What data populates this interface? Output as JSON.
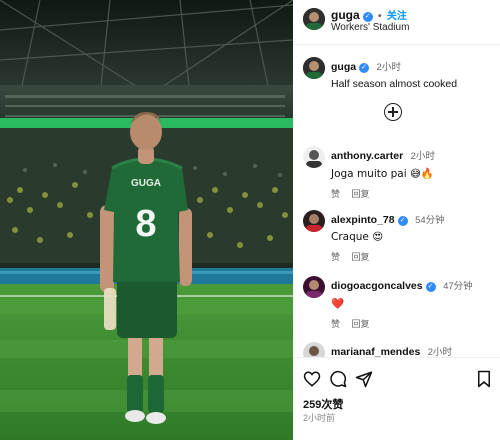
{
  "header": {
    "username": "guga",
    "verified_mark": "✓",
    "separator": "•",
    "follow_label": "关注",
    "location": "Workers' Stadium"
  },
  "photo": {
    "jersey_name": "GUGA",
    "jersey_number": "8"
  },
  "caption": {
    "username": "guga",
    "time": "2小时",
    "text": "Half season almost cooked"
  },
  "comments": [
    {
      "username": "anthony.carter",
      "verified": false,
      "time": "2小时",
      "text": "Joga muito pai 😅🔥",
      "like_label": "赞",
      "reply_label": "回复"
    },
    {
      "username": "alexpinto_78",
      "verified": true,
      "time": "54分钟",
      "text": "Craque 😍",
      "like_label": "赞",
      "reply_label": "回复"
    },
    {
      "username": "diogoacgoncalves",
      "verified": true,
      "time": "47分钟",
      "text": "❤️",
      "like_label": "赞",
      "reply_label": "回复"
    },
    {
      "username": "marianaf_mendes",
      "verified": false,
      "time": "2小时",
      "text": "",
      "like_label": "",
      "reply_label": ""
    }
  ],
  "footer": {
    "likes": "259次赞",
    "posted_ago": "2小时前"
  },
  "colors": {
    "follow": "#0095f6",
    "verified": "#2f8bff",
    "pitch": "#3f8a33",
    "jersey": "#1f6a37"
  },
  "icons": [
    "heart-icon",
    "comment-icon",
    "share-icon",
    "bookmark-icon",
    "add-comment-icon",
    "verified-icon"
  ]
}
